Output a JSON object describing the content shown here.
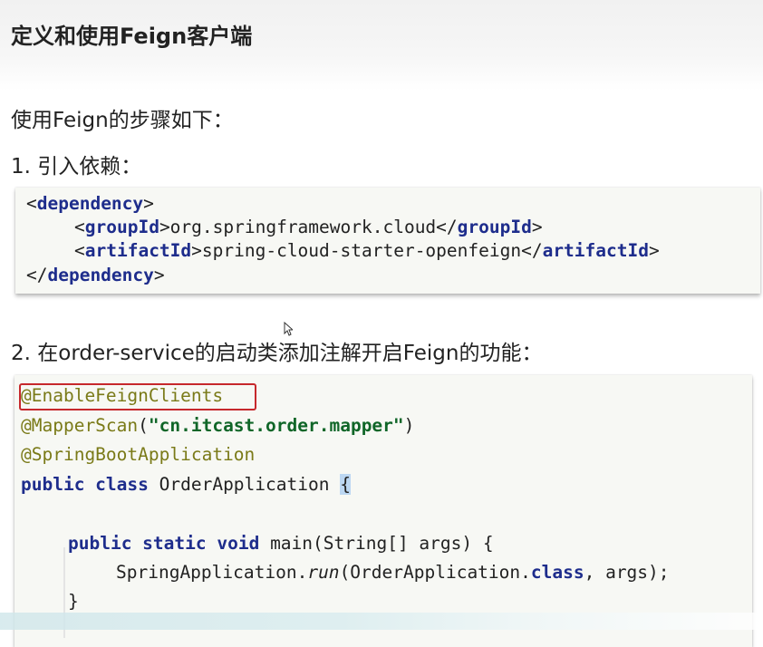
{
  "page": {
    "title": "定义和使用Feign客户端",
    "intro": "使用Feign的步骤如下：",
    "step1": "1.   引入依赖：",
    "step2": "2.   在order-service的启动类添加注解开启Feign的功能："
  },
  "dependency_snippet": {
    "line1_open": "<",
    "line1_tag": "dependency",
    "line1_close": ">",
    "line2_open": "<",
    "line2_tag": "groupId",
    "line2_text": ">org.springframework.cloud</",
    "line2_tag2": "groupId",
    "line2_close": ">",
    "line3_open": "<",
    "line3_tag": "artifactId",
    "line3_text": ">spring-cloud-starter-openfeign</",
    "line3_tag2": "artifactId",
    "line3_close": ">",
    "line4_open": "</",
    "line4_tag": "dependency",
    "line4_close": ">"
  },
  "java_snippet": {
    "ann1": "@EnableFeignClients",
    "ann2": "@MapperScan",
    "ann2_paren_open": "(",
    "ann2_arg": "\"cn.itcast.order.mapper\"",
    "ann2_paren_close": ")",
    "ann3": "@SpringBootApplication",
    "class_kw": "public class",
    "class_name": " OrderApplication ",
    "class_brace": "{",
    "method_kw": "public static void",
    "method_rest": " main(String[] args) {",
    "call_prefix": "SpringApplication.",
    "call_method": "run",
    "call_args_prefix": "(OrderApplication.",
    "call_class_kw": "class",
    "call_args_suffix": ", args);",
    "close_brace": "}"
  },
  "colors": {
    "tag": "#1e2d8c",
    "annotation": "#7a7a18",
    "string": "#106628",
    "highlight_border": "#c6282c",
    "brace_highlight": "#bcd7f2"
  }
}
